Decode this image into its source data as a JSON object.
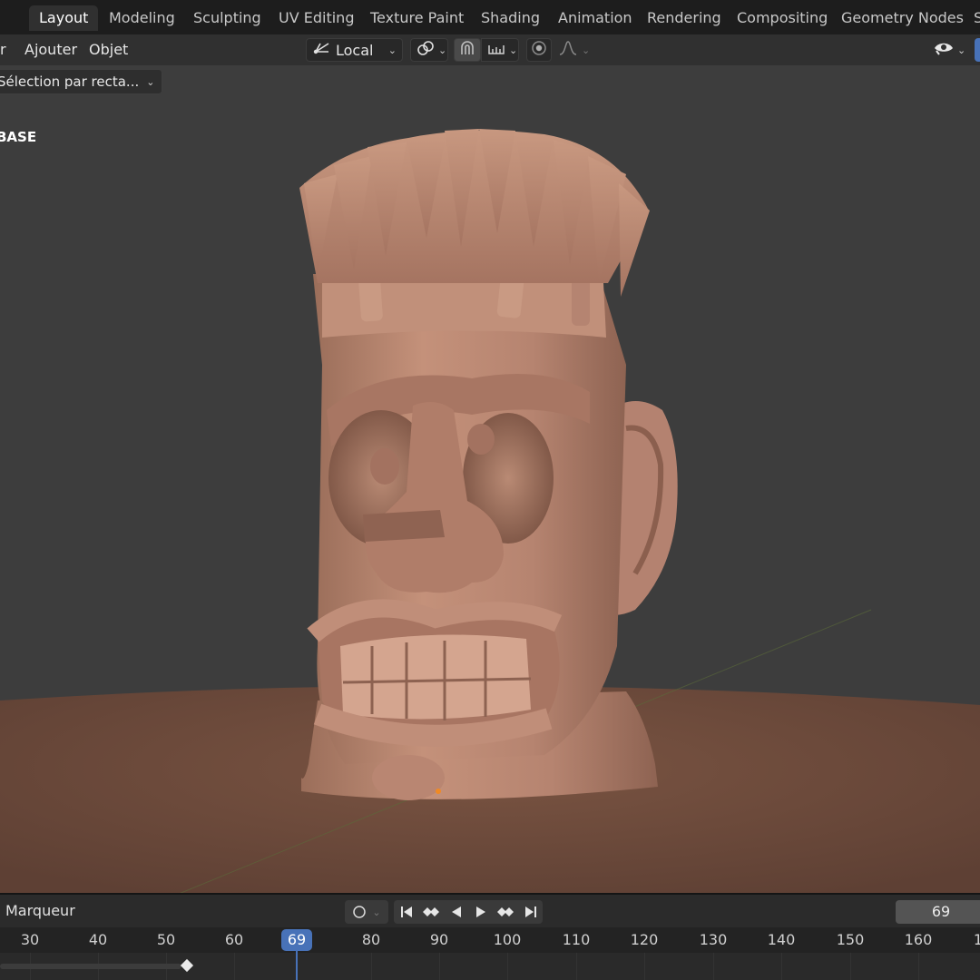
{
  "workspace_tabs": [
    "Layout",
    "Modeling",
    "Sculpting",
    "UV Editing",
    "Texture Paint",
    "Shading",
    "Animation",
    "Rendering",
    "Compositing",
    "Geometry Nodes",
    "S"
  ],
  "active_tab": "Layout",
  "header": {
    "menus": [
      "r",
      "Ajouter",
      "Objet"
    ],
    "transform_orientation": "Local",
    "select_tool": "Sélection par recta..."
  },
  "viewport": {
    "view_label": "BASE"
  },
  "timeline": {
    "marker_menu": "Marqueur",
    "current_frame": "69",
    "ruler_ticks": [
      "30",
      "40",
      "50",
      "60",
      "69",
      "80",
      "90",
      "100",
      "110",
      "120",
      "130",
      "140",
      "150",
      "160",
      "1"
    ]
  },
  "icons": {
    "orientation": "orientation-icon",
    "pivot": "pivot-icon",
    "snap": "snap-magnet-icon",
    "snap_target": "snap-increment-icon",
    "proportional": "proportional-edit-icon",
    "falloff": "falloff-curve-icon",
    "visibility": "eye-icon",
    "jump_start": "jump-start-icon",
    "prev_key": "previous-keyframe-icon",
    "play_reverse": "play-reverse-icon",
    "play": "play-icon",
    "next_key": "next-keyframe-icon",
    "jump_end": "jump-end-icon"
  },
  "colors": {
    "accent": "#4872b8",
    "viewport_bg": "#3d3d3d",
    "clay": "#b88670",
    "floor": "#6e4c3c"
  }
}
